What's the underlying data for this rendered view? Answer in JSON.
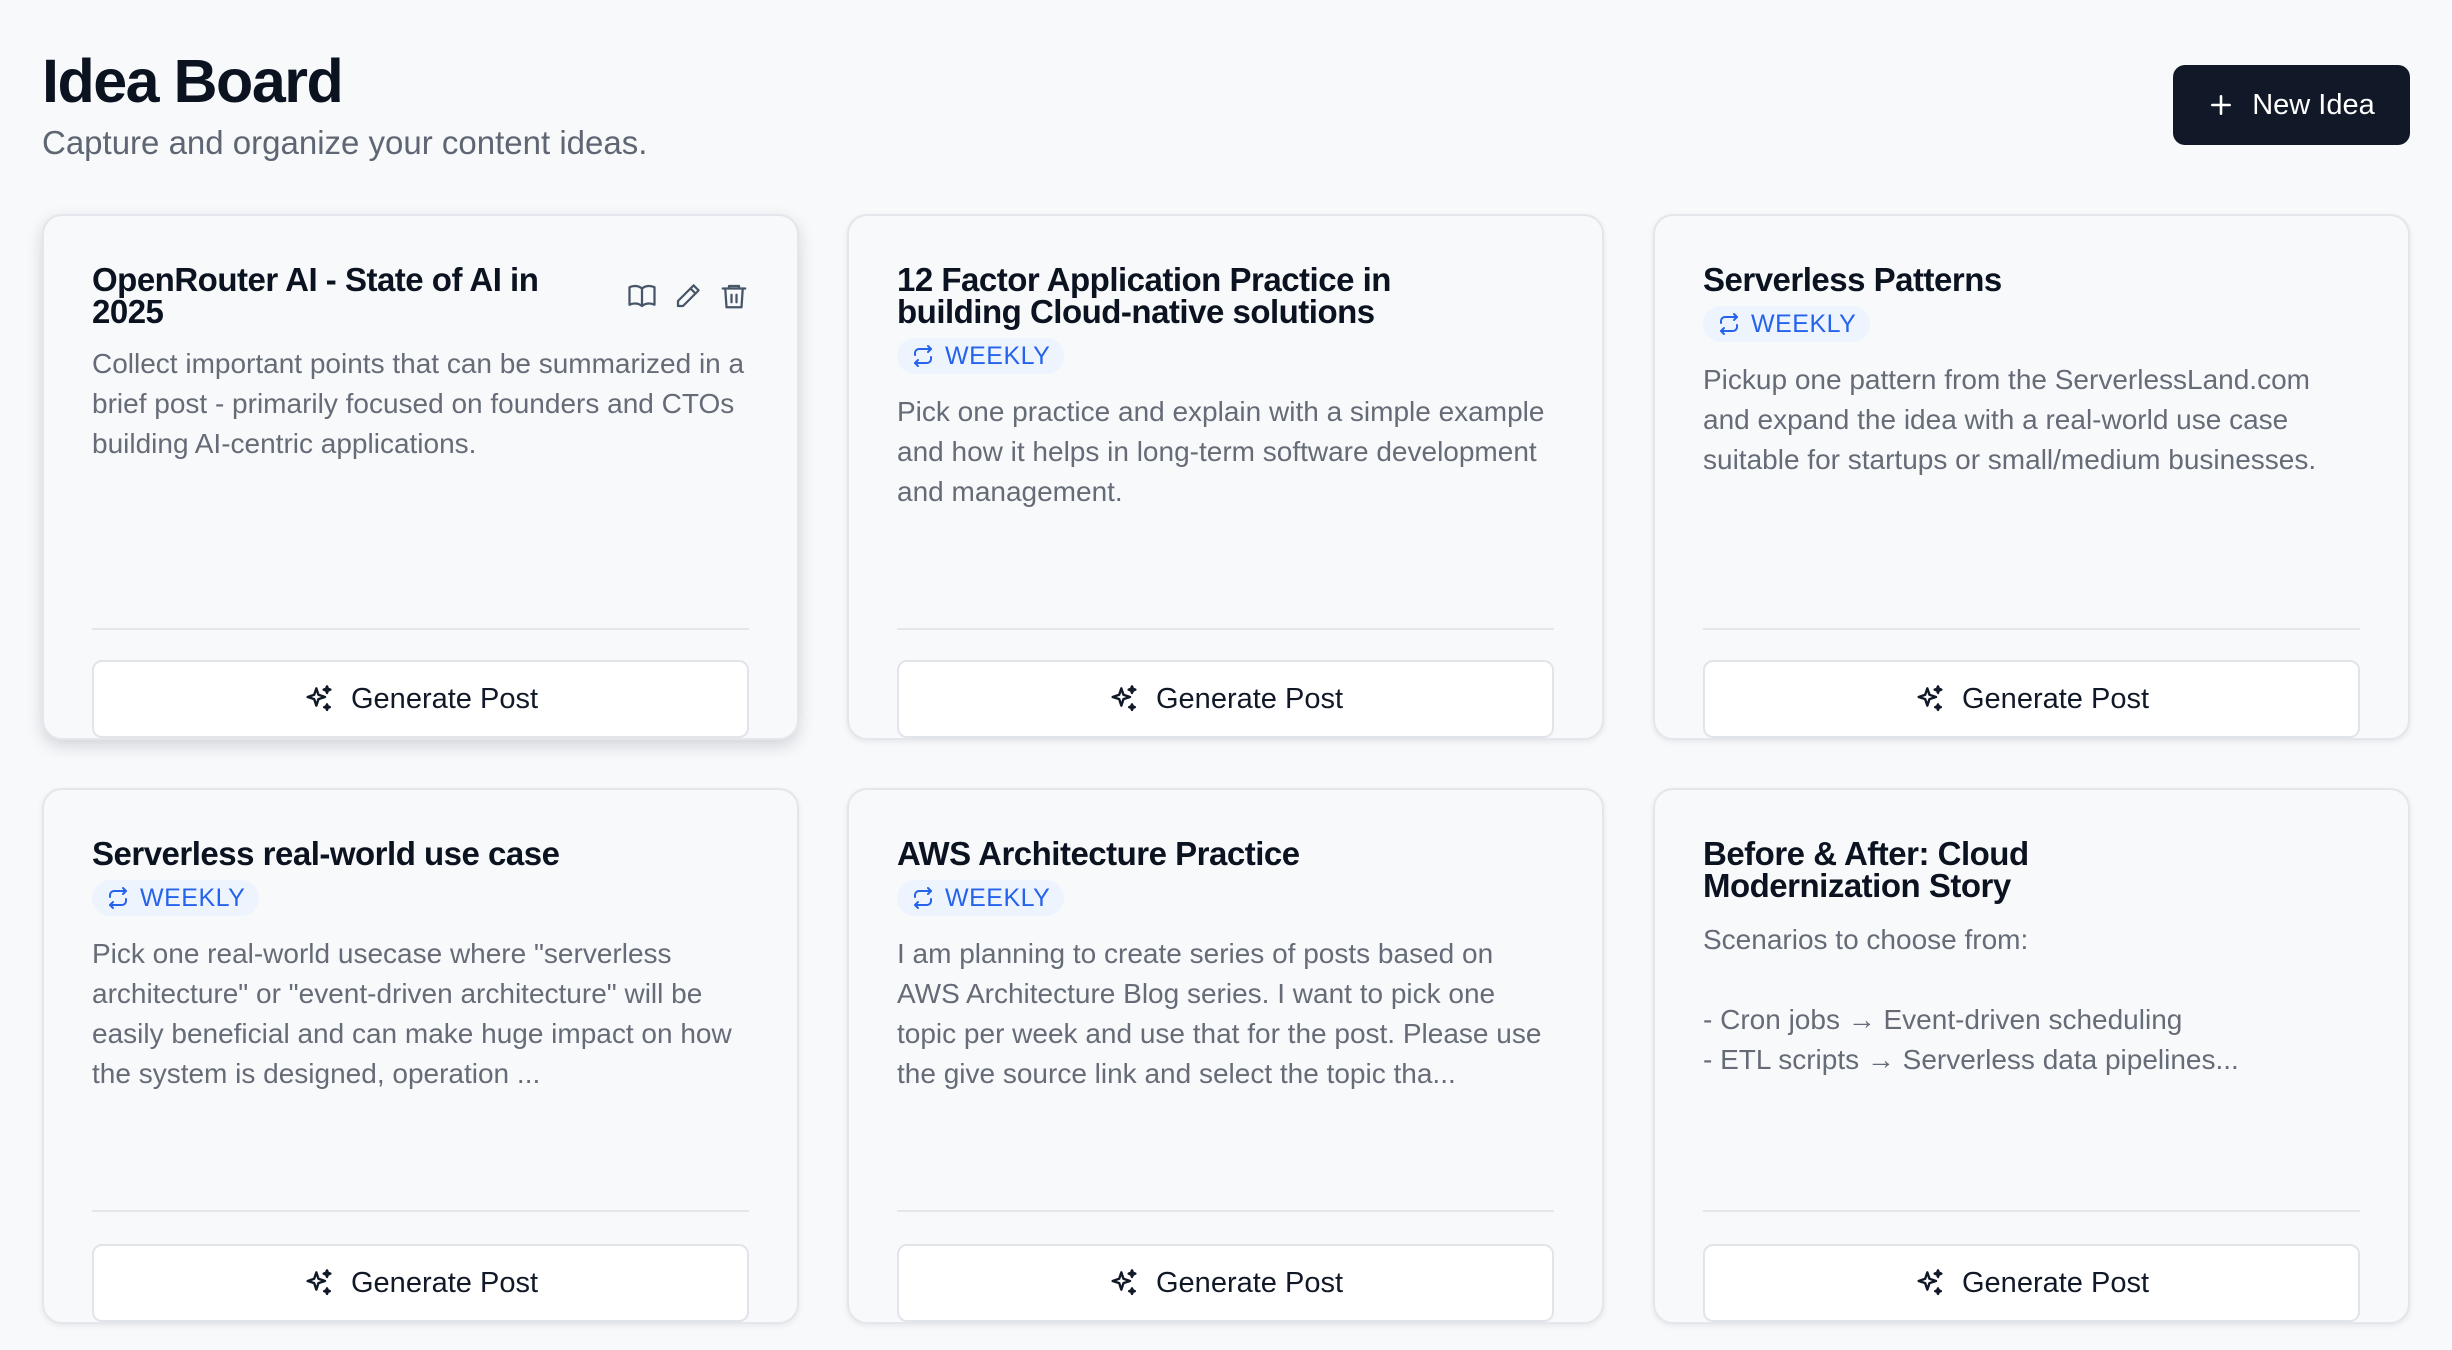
{
  "header": {
    "title": "Idea Board",
    "subtitle": "Capture and organize your content ideas.",
    "new_idea_label": "New Idea"
  },
  "colors": {
    "primary_button": "#111827",
    "badge_bg": "#eef4fd",
    "badge_text": "#2563eb",
    "card_border": "#e3e6eb"
  },
  "cards": [
    {
      "title": "OpenRouter AI - State of AI in 2025",
      "badge": "",
      "description": "Collect important points that can be summarized in a brief post - primarily focused on founders and CTOs building AI-centric applications.",
      "button": "Generate Post",
      "actions": [
        "book-open-icon",
        "pencil-icon",
        "trash-icon"
      ]
    },
    {
      "title": "12 Factor Application Practice in building Cloud-native solutions",
      "badge": "WEEKLY",
      "description": "Pick one practice and explain with a simple example and how it helps in long-term software development and management.",
      "button": "Generate Post"
    },
    {
      "title": "Serverless Patterns",
      "badge": "WEEKLY",
      "description": "Pickup one pattern from the ServerlessLand.com and expand the idea with a real-world use case suitable for startups or small/medium businesses.",
      "button": "Generate Post"
    },
    {
      "title": "Serverless real-world use case",
      "badge": "WEEKLY",
      "description": "Pick one real-world usecase where \"serverless architecture\" or \"event-driven architecture\" will be easily beneficial and can make huge impact on how the system is designed, operation ...",
      "button": "Generate Post"
    },
    {
      "title": "AWS Architecture Practice",
      "badge": "WEEKLY",
      "description": "I am planning to create series of posts based on AWS Architecture Blog series. I want to pick one topic per week and use that for the post. Please use the give source link and select the topic tha...",
      "button": "Generate Post"
    },
    {
      "title": "Before & After: Cloud Modernization Story",
      "badge": "",
      "description": "Scenarios to choose from:\n\n- Cron jobs → Event-driven scheduling\n- ETL scripts → Serverless data pipelines...",
      "button": "Generate Post"
    }
  ]
}
